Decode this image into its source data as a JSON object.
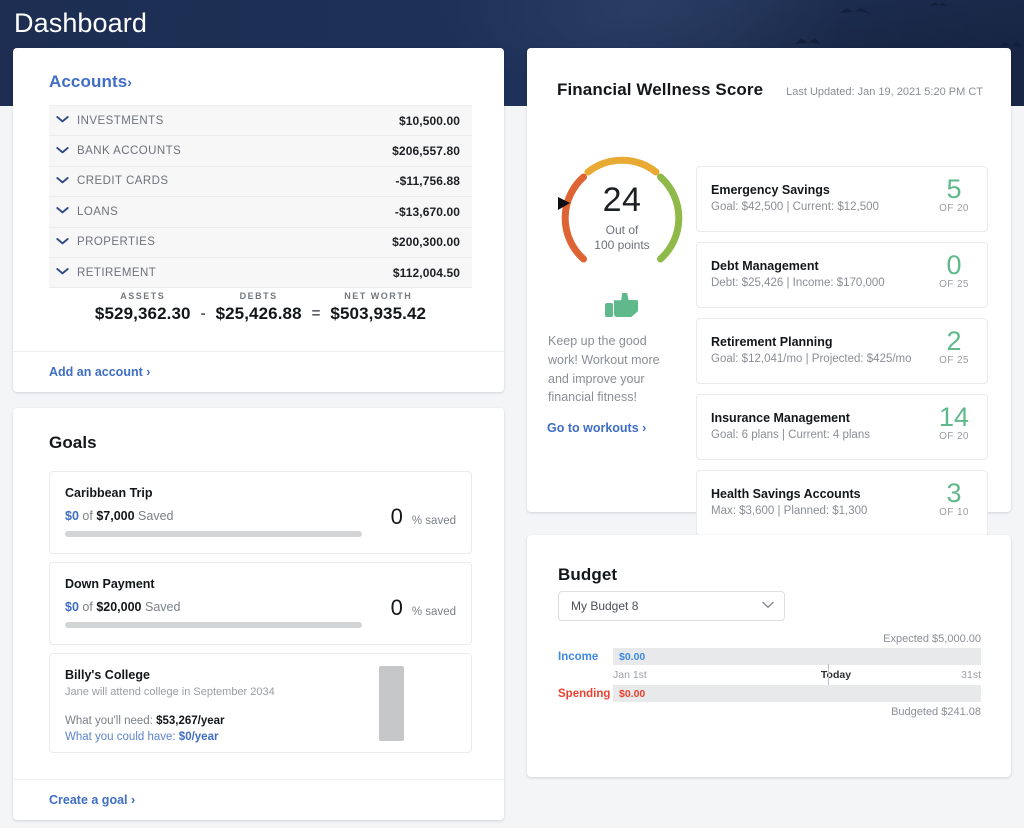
{
  "header": {
    "title": "Dashboard"
  },
  "accounts": {
    "link_label": "Accounts",
    "chevron": "›",
    "rows": [
      {
        "name": "INVESTMENTS",
        "amount": "$10,500.00"
      },
      {
        "name": "BANK ACCOUNTS",
        "amount": "$206,557.80"
      },
      {
        "name": "CREDIT CARDS",
        "amount": "-$11,756.88"
      },
      {
        "name": "LOANS",
        "amount": "-$13,670.00"
      },
      {
        "name": "PROPERTIES",
        "amount": "$200,300.00"
      },
      {
        "name": "RETIREMENT",
        "amount": "$112,004.50"
      }
    ],
    "summary": {
      "assets_label": "ASSETS",
      "assets_value": "$529,362.30",
      "minus": "-",
      "debts_label": "DEBTS",
      "debts_value": "$25,426.88",
      "equals": "=",
      "networth_label": "NET WORTH",
      "networth_value": "$503,935.42"
    },
    "footer_link": "Add an account ›"
  },
  "goals": {
    "title": "Goals",
    "items": [
      {
        "name": "Caribbean Trip",
        "saved": "$0",
        "of_word": "of",
        "target": "$7,000",
        "saved_word": "Saved",
        "percent": "0",
        "percent_label": "% saved",
        "progress": 0
      },
      {
        "name": "Down Payment",
        "saved": "$0",
        "of_word": "of",
        "target": "$20,000",
        "saved_word": "Saved",
        "percent": "0",
        "percent_label": "% saved",
        "progress": 0
      }
    ],
    "college": {
      "name": "Billy's College",
      "subtitle": "Jane will attend college in September 2034",
      "need_label": "What you'll need: ",
      "need_value": "$53,267/year",
      "could_label": "What you could have: ",
      "could_value": "$0/year"
    },
    "footer_link": "Create a goal ›"
  },
  "wellness": {
    "title": "Financial Wellness Score",
    "last_updated": "Last Updated: Jan 19, 2021 5:20 PM CT",
    "gauge": {
      "score": "24",
      "out_of_line1": "Out of",
      "out_of_line2": "100 points",
      "max": 100,
      "color_low": "#de6434",
      "color_mid": "#e8aa32",
      "color_high": "#8fba4a"
    },
    "encouragement": "Keep up the good work! Workout more and improve your financial fitness!",
    "workouts_link": "Go to workouts  ›",
    "scores": [
      {
        "name": "Emergency Savings",
        "detail": "Goal: $42,500 | Current: $12,500",
        "value": "5",
        "of": "OF 20"
      },
      {
        "name": "Debt Management",
        "detail": "Debt: $25,426 | Income: $170,000",
        "value": "0",
        "of": "OF 25"
      },
      {
        "name": "Retirement Planning",
        "detail": "Goal: $12,041/mo | Projected: $425/mo",
        "value": "2",
        "of": "OF 25"
      },
      {
        "name": "Insurance Management",
        "detail": "Goal: 6 plans | Current: 4 plans",
        "value": "14",
        "of": "OF 20"
      },
      {
        "name": "Health Savings Accounts",
        "detail": "Max: $3,600 | Planned: $1,300",
        "value": "3",
        "of": "OF 10"
      }
    ]
  },
  "budget": {
    "title": "Budget",
    "selected_budget": "My Budget 8",
    "select_chevron": "⌄",
    "expected_note": "Expected $5,000.00",
    "budgeted_note": "Budgeted $241.08",
    "income_label": "Income",
    "income_value": "$0.00",
    "spending_label": "Spending",
    "spending_value": "$0.00",
    "axis_start": "Jan 1st",
    "axis_today": "Today",
    "axis_end": "31st"
  }
}
